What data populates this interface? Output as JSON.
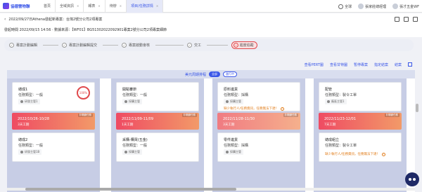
{
  "app": {
    "logo_text": "協德營物聯"
  },
  "nav": {
    "tabs": [
      {
        "label": "首頁",
        "active": false
      },
      {
        "label": "全域資訊",
        "active": false,
        "closable": true
      },
      {
        "label": "報表",
        "active": false,
        "closable": true
      },
      {
        "label": "待辦",
        "active": false,
        "closable": true
      },
      {
        "label": "項目/任務詳情",
        "active": true,
        "closable": true
      }
    ],
    "close_glyph": "✕"
  },
  "top_right": {
    "language": "全球",
    "user": "張家莊總經理",
    "company": "張才五金WF"
  },
  "header": {
    "back_glyph": "‹",
    "breadcrumb": "2022/09/27日Athena發起新專案：台灣2號分公司2項專案",
    "subtitle": "發起時間 2022/09/15 14:56 · 數據來源：【WF01】BG51302022092901專案2號分公司2項專案細節"
  },
  "steps": [
    {
      "label": "專案計劃編輯",
      "status": "done"
    },
    {
      "label": "專案計劃編輯提交",
      "status": "done"
    },
    {
      "label": "專案啟動會核",
      "status": "done"
    },
    {
      "label": "交工",
      "status": "done"
    },
    {
      "label": "進度追蹤",
      "status": "current"
    }
  ],
  "toolbar": {
    "items": [
      "查看PERT圖",
      "查看甘特圖",
      "暫停專案",
      "指定結案",
      "結案"
    ]
  },
  "board": {
    "title": "美元周期排程",
    "toggle_on": "全部",
    "toggle_off": "進行中",
    "columns": [
      {
        "cards": [
          {
            "name": "總成1",
            "type": "任務類型：一般",
            "owner": "研發主管1",
            "progress": "100%"
          },
          {
            "name": "總成2",
            "type": "任務類型：一般",
            "owner": "研發主管1B"
          }
        ],
        "date": {
          "range": "2022/10/26-10/28",
          "duration": "3天工期",
          "tag": "非關鍵任務"
        }
      },
      {
        "cards": [
          {
            "name": "開點審辦",
            "type": "任務類型：一般",
            "owner": "採購主管"
          },
          {
            "name": "采購-購買(五金)",
            "type": "任務類型：一般",
            "owner": "採購主管"
          }
        ],
        "date": {
          "range": "2022/11/09-11/09",
          "duration": "1天工期",
          "tag": "非關鍵任務"
        }
      },
      {
        "cards": [
          {
            "name": "原料進貨",
            "type": "任務類型：採購",
            "owner": "採購主管",
            "warning": "缺少執行人/任務資訊，任務無法下達！"
          },
          {
            "name": "零件進貨",
            "type": "任務類型：採購",
            "owner": "採購主管"
          }
        ],
        "date": {
          "range": "2022/11/28-11/30",
          "duration": "3天工期",
          "tag": "非關鍵任務"
        }
      },
      {
        "cards": [
          {
            "name": "配管",
            "type": "任務類型：製令工單",
            "owner": "廠區主管1"
          },
          {
            "name": "總成組立",
            "type": "任務類型：製令工單",
            "owner": "",
            "warning": "缺少執行人/任務資訊，任務無法下達！"
          }
        ],
        "date": {
          "range": "2022/11/23-12/01",
          "duration": "7天工期",
          "tag": "非關鍵任務"
        }
      }
    ]
  },
  "colors": {
    "accent": "#3a57e8",
    "danger": "#e0494c",
    "warning": "#e07a16",
    "date_band_start": "#ef4b63",
    "date_band_end": "#f29a68"
  }
}
